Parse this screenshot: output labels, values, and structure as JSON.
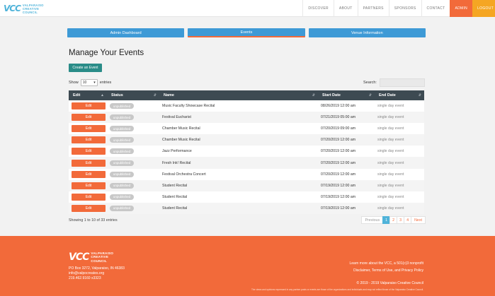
{
  "header": {
    "logo_mark": "VCC",
    "logo_lines": [
      "VALPARAISO",
      "CREATIVE",
      "COUNCIL"
    ],
    "nav": [
      "DISCOVER",
      "ABOUT",
      "PARTNERS",
      "SPONSORS",
      "CONTACT",
      "ADMIN",
      "LOGOUT"
    ]
  },
  "tabs": [
    "Admin Dashboard",
    "Events",
    "Venue Information"
  ],
  "page_title": "Manage Your Events",
  "create_button": "Create an Event",
  "length": {
    "label_before": "Show",
    "value": "10",
    "label_after": "entries"
  },
  "search": {
    "label": "Search:",
    "value": ""
  },
  "table": {
    "columns": [
      "Edit",
      "Status",
      "Name",
      "Start Date",
      "End Date"
    ],
    "rows": [
      {
        "edit": "Edit",
        "status": "unpublished",
        "name": "Music Faculty Showcase Recital",
        "start": "08/26/2019 12:00 am",
        "end": "single day event"
      },
      {
        "edit": "Edit",
        "status": "unpublished",
        "name": "Festival Eucharist",
        "start": "07/21/2019 05:00 am",
        "end": "single day event"
      },
      {
        "edit": "Edit",
        "status": "unpublished",
        "name": "Chamber Music Recital",
        "start": "07/20/2019 09:00 am",
        "end": "single day event"
      },
      {
        "edit": "Edit",
        "status": "unpublished",
        "name": "Chamber Music Recital",
        "start": "07/20/2019 12:00 am",
        "end": "single day event"
      },
      {
        "edit": "Edit",
        "status": "unpublished",
        "name": "Jazz Performance",
        "start": "07/20/2019 12:00 am",
        "end": "single day event"
      },
      {
        "edit": "Edit",
        "status": "unpublished",
        "name": "Fresh Ink! Recital",
        "start": "07/20/2019 12:00 am",
        "end": "single day event"
      },
      {
        "edit": "Edit",
        "status": "unpublished",
        "name": "Festival Orchestra Concert",
        "start": "07/20/2019 12:00 am",
        "end": "single day event"
      },
      {
        "edit": "Edit",
        "status": "unpublished",
        "name": "Student Recital",
        "start": "07/19/2019 12:00 am",
        "end": "single day event"
      },
      {
        "edit": "Edit",
        "status": "unpublished",
        "name": "Student Recital",
        "start": "07/19/2019 12:00 am",
        "end": "single day event"
      },
      {
        "edit": "Edit",
        "status": "unpublished",
        "name": "Student Recital",
        "start": "07/19/2019 12:00 am",
        "end": "single day event"
      }
    ]
  },
  "info": "Showing 1 to 10 of 33 entries",
  "pagination": {
    "previous": "Previous",
    "pages": [
      "1",
      "2",
      "3",
      "4"
    ],
    "current": "1",
    "next": "Next"
  },
  "footer": {
    "logo_mark": "VCC",
    "logo_lines": [
      "VALPARAISO",
      "CREATIVE",
      "COUNCIL"
    ],
    "address_lines": [
      "PO Box 3272, Valparaiso, IN 46383",
      "info@valpocreates.org",
      "219.462.9160 x3323"
    ],
    "right_lines": [
      "Learn more about the VCC, a 501(c)3 nonprofit",
      "Disclaimer, Terms of Use, and Privacy Policy"
    ],
    "copyright": "© 2019 - 2019 Valparaiso Creative Council",
    "disclaimer": "The views and opinions expressed in any partner posts or events are those of the organizations and individuals and may not reflect those of the Valparaiso Creative Council."
  },
  "colors": {
    "accent": "#f26a3a",
    "primary": "#3e9ad6",
    "teal": "#2a8c88",
    "table_header": "#3d4a52"
  }
}
